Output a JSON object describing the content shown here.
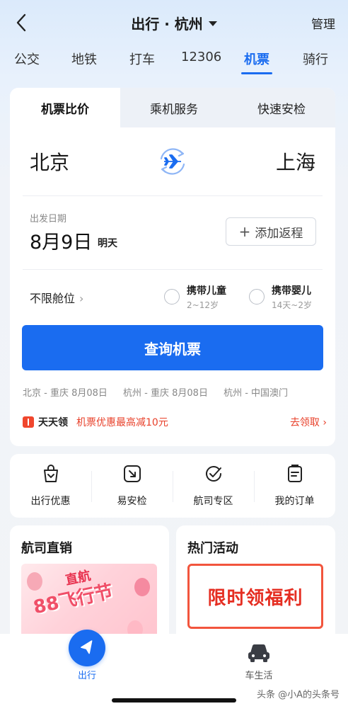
{
  "header": {
    "title": "出行 · 杭州",
    "manage_label": "管理"
  },
  "modes": [
    {
      "label": "公交",
      "active": false
    },
    {
      "label": "地铁",
      "active": false
    },
    {
      "label": "打车",
      "active": false
    },
    {
      "label": "12306",
      "active": false
    },
    {
      "label": "机票",
      "active": true
    },
    {
      "label": "骑行",
      "active": false
    }
  ],
  "flight": {
    "tabs": [
      {
        "label": "机票比价",
        "active": true
      },
      {
        "label": "乘机服务",
        "active": false
      },
      {
        "label": "快速安检",
        "active": false
      }
    ],
    "from_city": "北京",
    "to_city": "上海",
    "date_label": "出发日期",
    "date_value": "8月9日",
    "date_sub": "明天",
    "return_label": "添加返程",
    "cabin_label": "不限舱位",
    "child": {
      "label": "携带儿童",
      "sub": "2~12岁"
    },
    "infant": {
      "label": "携带婴儿",
      "sub": "14天~2岁"
    },
    "search_label": "查询机票",
    "history": [
      "北京 - 重庆  8月08日",
      "杭州 - 重庆  8月08日",
      "杭州 - 中国澳门"
    ],
    "promo": {
      "brand": "天天领",
      "text": "机票优惠最高减10元",
      "action": "去领取 ›"
    }
  },
  "services": [
    {
      "label": "出行优惠",
      "icon": "gift-bag-icon"
    },
    {
      "label": "易安检",
      "icon": "security-check-icon"
    },
    {
      "label": "航司专区",
      "icon": "airline-badge-icon"
    },
    {
      "label": "我的订单",
      "icon": "order-list-icon"
    }
  ],
  "promo_cards": {
    "left_title": "航司直销",
    "left_banner_line1": "直航",
    "left_banner_line2": "88飞行节",
    "right_title": "热门活动",
    "right_banner": "限时领福利"
  },
  "bottom_nav": {
    "go_label": "出行",
    "car_label": "车生活",
    "watermark": "头条 @小A的头条号"
  },
  "colors": {
    "accent": "#1a6cf0",
    "promo_red": "#e8402a"
  }
}
